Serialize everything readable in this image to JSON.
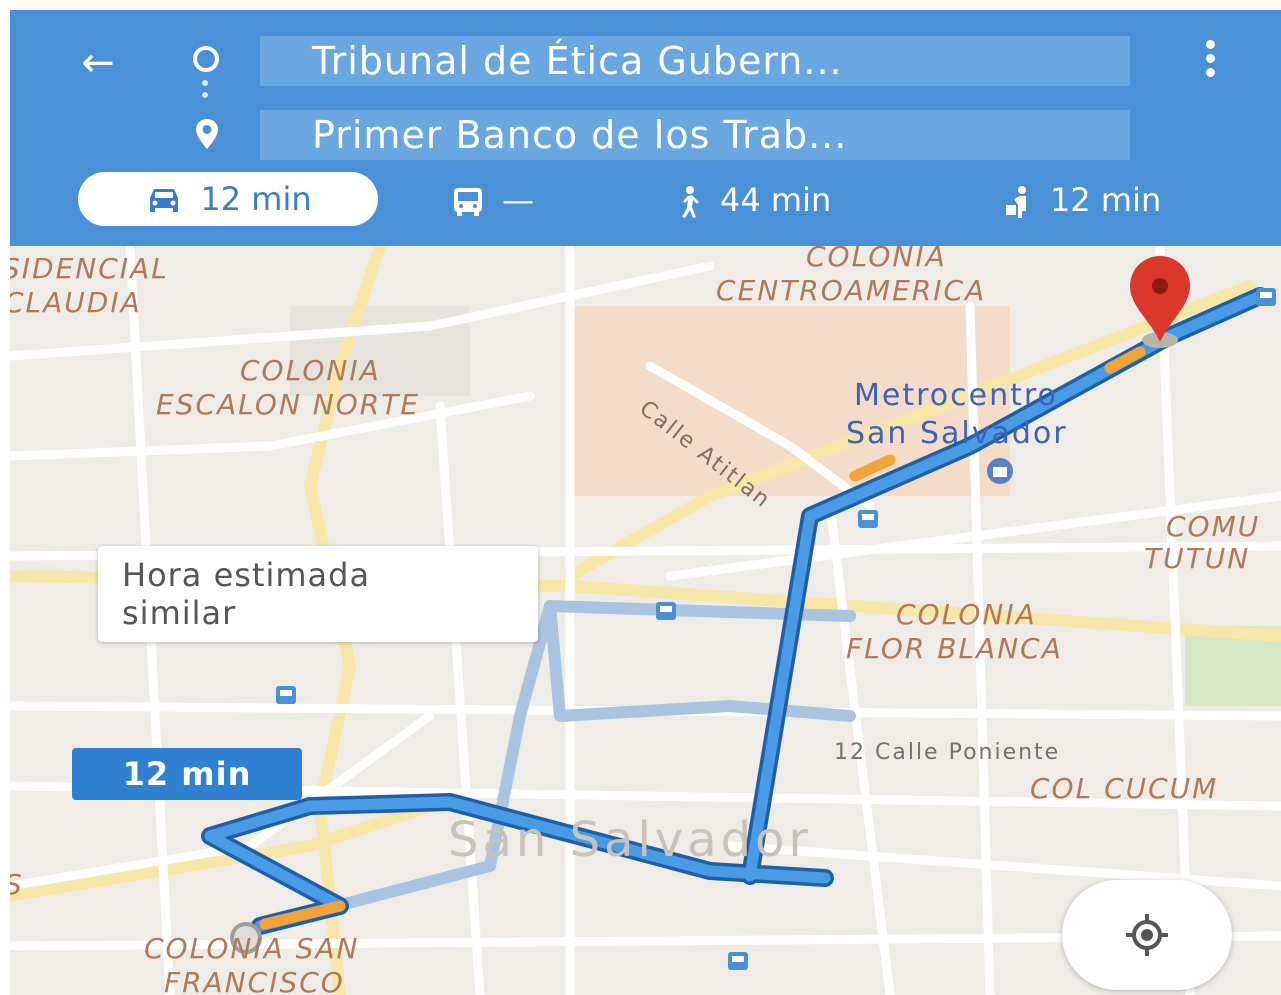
{
  "header": {
    "back_icon": "arrow-left-icon",
    "origin": "Tribunal de Ética Gubern...",
    "destination": "Primer Banco de los Trab...",
    "more_icon": "more-vertical-icon"
  },
  "modes": [
    {
      "icon": "car-icon",
      "label": "12 min",
      "active": true
    },
    {
      "icon": "bus-icon",
      "label": "—",
      "active": false
    },
    {
      "icon": "walk-icon",
      "label": "44 min",
      "active": false
    },
    {
      "icon": "ride-icon",
      "label": "12 min",
      "active": false
    }
  ],
  "map": {
    "labels": {
      "residencial": "SIDENCIAL",
      "claudia": "CLAUDIA",
      "colonia_centroamerica_1": "COLONIA",
      "colonia_centroamerica_2": "CENTROAMERICA",
      "colonia_escalon_1": "COLONIA",
      "colonia_escalon_2": "ESCALON NORTE",
      "calle_atitlan": "Calle Atitlan",
      "metrocentro_1": "Metrocentro",
      "metrocentro_2": "San Salvador",
      "comu": "COMU",
      "tutun": "TUTUN",
      "flor_blanca_1": "COLONIA",
      "flor_blanca_2": "FLOR BLANCA",
      "calle_poniente": "12 Calle Poniente",
      "col_cucuma": "COL CUCUM",
      "city": "San Salvador",
      "san_francisco_1": "COLONIA SAN",
      "san_francisco_2": "FRANCISCO",
      "edge_left": "S"
    },
    "route_colors": {
      "primary": "#2f80d1",
      "alternate": "#a9c4e0",
      "traffic": "#f2a33a"
    },
    "destination_pin_color": "#d9382b"
  },
  "tooltip": {
    "line1": "Hora estimada",
    "line2": "similar"
  },
  "route_badge": "12 min",
  "my_location_icon": "crosshair-icon"
}
